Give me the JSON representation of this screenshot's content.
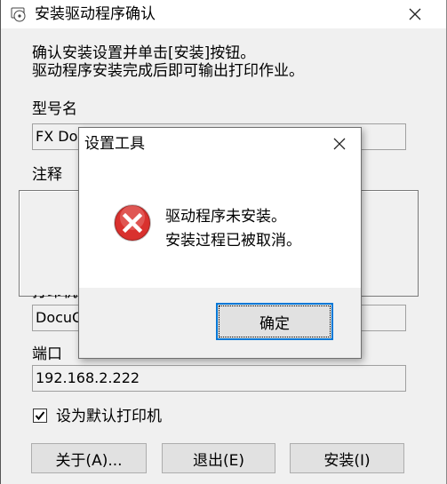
{
  "window": {
    "title": "安装驱动程序确认",
    "icons": {
      "app": "printer-disc-icon",
      "close": "close-icon"
    }
  },
  "intro": {
    "line1": "确认安装设置并单击[安装]按钮。",
    "line2": "驱动程序安装完成后即可输出打印作业。"
  },
  "model": {
    "label": "型号名",
    "value": "FX Docu"
  },
  "comment": {
    "label": "注释",
    "value": ""
  },
  "printer_name": {
    "value": "DocuC"
  },
  "port": {
    "label": "端口",
    "value": "192.168.2.222"
  },
  "default_printer": {
    "label": "设为默认打印机",
    "checked": true
  },
  "buttons": {
    "about": "关于(A)...",
    "exit": "退出(E)",
    "install": "安装(I)"
  },
  "dialog": {
    "title": "设置工具",
    "message_line1": "驱动程序未安装。",
    "message_line2": "安装过程已被取消。",
    "ok": "确定",
    "icon": "error-icon",
    "colors": {
      "error_red": "#d9312e",
      "focus_blue": "#0078d7"
    }
  }
}
